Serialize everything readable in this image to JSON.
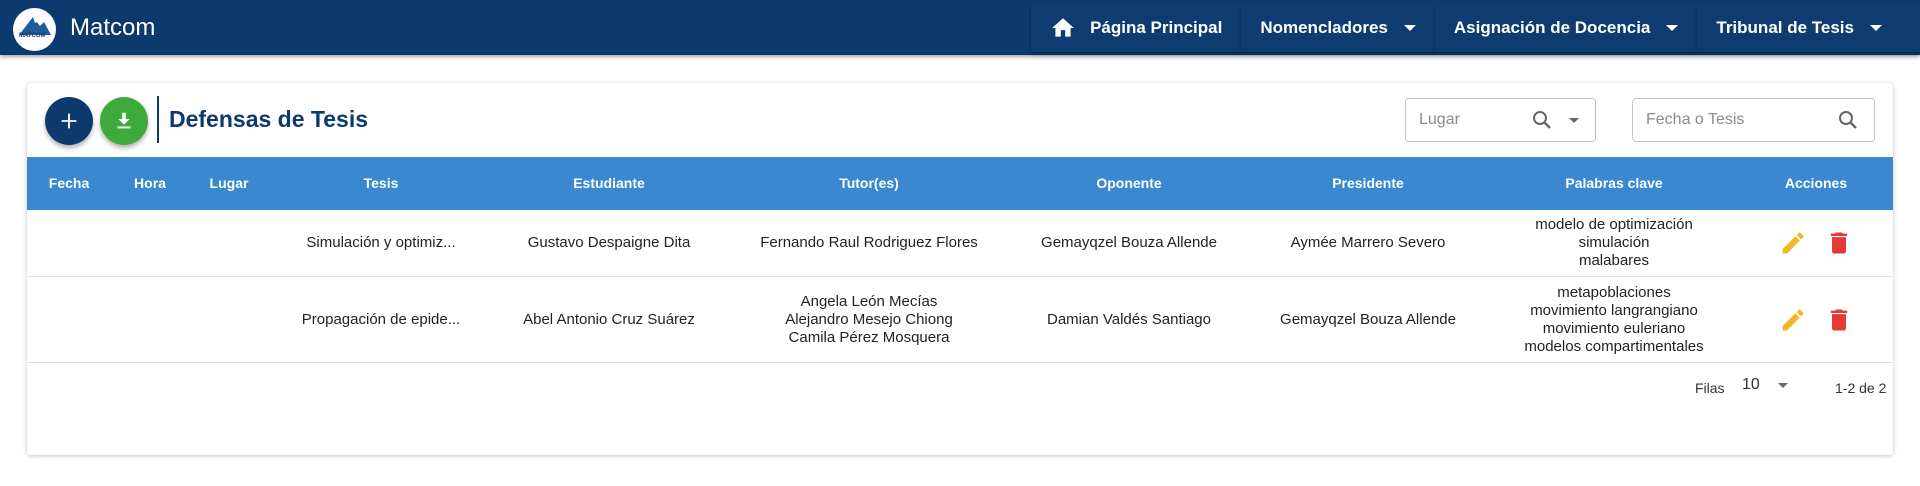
{
  "app": {
    "logo_text": "MATCOM",
    "brand": "Matcom"
  },
  "nav": [
    {
      "label": "Página Principal",
      "icon": "home-icon"
    },
    {
      "label": "Nomencladores",
      "icon": "chevron-down-icon"
    },
    {
      "label": "Asignación de Docencia",
      "icon": "chevron-down-icon"
    },
    {
      "label": "Tribunal de Tesis",
      "icon": "chevron-down-icon"
    }
  ],
  "page": {
    "title": "Defensas de Tesis",
    "filters": {
      "lugar_placeholder": "Lugar",
      "fecha_placeholder": "Fecha o Tesis"
    }
  },
  "table": {
    "columns": [
      "Fecha",
      "Hora",
      "Lugar",
      "Tesis",
      "Estudiante",
      "Tutor(es)",
      "Oponente",
      "Presidente",
      "Palabras clave",
      "Acciones"
    ],
    "rows": [
      {
        "fecha": "",
        "hora": "",
        "lugar": "",
        "tesis": "Simulación y optimiz...",
        "estudiante": "Gustavo Despaigne Dita",
        "tutores": [
          "Fernando Raul Rodriguez Flores"
        ],
        "oponente": "Gemayqzel Bouza Allende",
        "presidente": "Aymée Marrero Severo",
        "palabras": [
          "modelo de optimización",
          "simulación",
          "malabares"
        ]
      },
      {
        "fecha": "",
        "hora": "",
        "lugar": "",
        "tesis": "Propagación de epide...",
        "estudiante": "Abel Antonio Cruz Suárez",
        "tutores": [
          "Angela León Mecías",
          "Alejandro Mesejo Chiong",
          "Camila Pérez Mosquera"
        ],
        "oponente": "Damian Valdés Santiago",
        "presidente": "Gemayqzel Bouza Allende",
        "palabras": [
          "metapoblaciones",
          "movimiento langrangiano",
          "movimiento euleriano",
          "modelos compartimentales"
        ]
      }
    ],
    "footer": {
      "rows_label": "Filas",
      "rows_value": "10",
      "range": "1-2 de 2"
    }
  },
  "colors": {
    "primary": "#0d3a6e",
    "header_bg": "#3a88d0",
    "download": "#3faa3c",
    "edit": "#f2b824",
    "delete": "#e53935"
  }
}
